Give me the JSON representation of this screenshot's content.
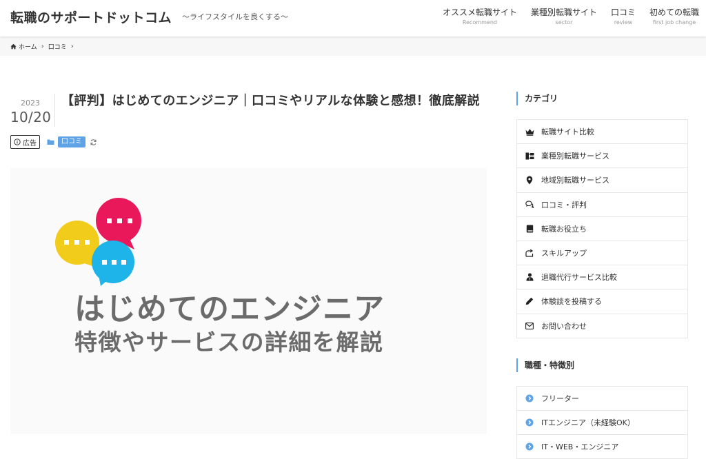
{
  "header": {
    "site_title": "転職のサポートドットコム",
    "tagline": "〜ライフスタイルを良くする〜",
    "nav": [
      {
        "ja": "オススメ転職サイト",
        "en": "Recommend"
      },
      {
        "ja": "業種別転職サイト",
        "en": "sector"
      },
      {
        "ja": "口コミ",
        "en": "review"
      },
      {
        "ja": "初めての転職",
        "en": "first job change"
      }
    ]
  },
  "breadcrumb": {
    "home": "ホーム",
    "category": "口コミ",
    "separator": "›"
  },
  "post": {
    "year": "2023",
    "month_day": "10/20",
    "title": "【評判】はじめてのエンジニア｜口コミやリアルな体験と感想！徹底解説",
    "ad_label": "広告",
    "category_tag": "口コミ",
    "eyecatch_line1": "はじめてのエンジニア",
    "eyecatch_line2": "特徴やサービスの詳細を解説"
  },
  "sidebar": {
    "category_heading": "カテゴリ",
    "categories": [
      {
        "label": "転職サイト比較",
        "icon": "crown-icon"
      },
      {
        "label": "業種別転職サービス",
        "icon": "sitemap-icon"
      },
      {
        "label": "地域別転職サービス",
        "icon": "map-pin-icon"
      },
      {
        "label": "口コミ・評判",
        "icon": "comments-icon"
      },
      {
        "label": "転職お役立ち",
        "icon": "book-icon"
      },
      {
        "label": "スキルアップ",
        "icon": "share-arrow-icon"
      },
      {
        "label": "退職代行サービス比較",
        "icon": "user-tie-icon"
      },
      {
        "label": "体験談を投稿する",
        "icon": "pen-icon"
      },
      {
        "label": "お問い合わせ",
        "icon": "envelope-icon"
      }
    ],
    "job_heading": "職種・特徴別",
    "jobs": [
      {
        "label": "フリーター",
        "icon": "chevron-circle-icon"
      },
      {
        "label": "ITエンジニア（未経験OK）",
        "icon": "chevron-circle-icon"
      },
      {
        "label": "IT・WEB・エンジニア",
        "icon": "chevron-circle-icon"
      }
    ]
  },
  "colors": {
    "accent": "#5ea3e6",
    "bubble_red": "#e8185a",
    "bubble_yellow": "#f2cc1a",
    "bubble_blue": "#1eb4ea",
    "eyecatch_text": "#6b6b6b"
  }
}
